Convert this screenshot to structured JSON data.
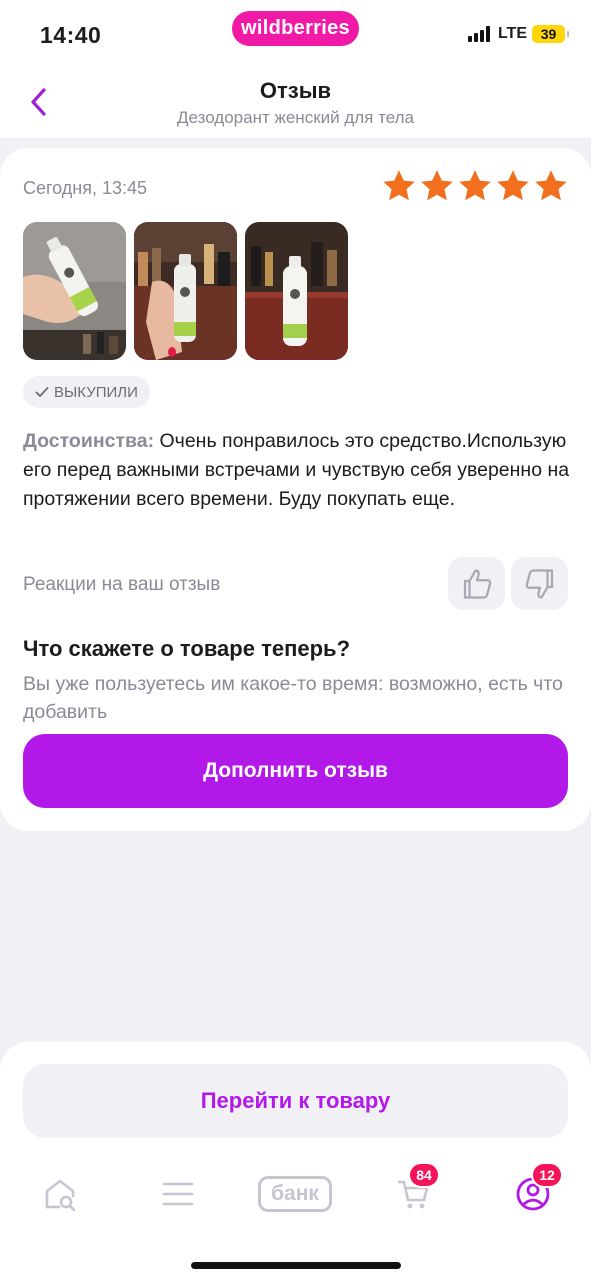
{
  "status_bar": {
    "time": "14:40",
    "brand": "wildberries",
    "network": "LTE",
    "battery": "39"
  },
  "header": {
    "title": "Отзыв",
    "subtitle": "Дезодорант женский для тела"
  },
  "review": {
    "date": "Сегодня, 13:45",
    "rating": 5,
    "photos": [
      "photo-1",
      "photo-2",
      "photo-3"
    ],
    "badge": "ВЫКУПИЛИ",
    "pros_label": "Достоинства:",
    "pros_text": "Очень понравилось это средство.Использую его перед важными встречами и чувствую себя уверенно на протяжении всего времени. Буду покупать еще.",
    "reactions_label": "Реакции на ваш отзыв"
  },
  "followup": {
    "title": "Что скажете о товаре теперь?",
    "description": "Вы уже пользуетесь им какое-то время: возможно, есть что добавить",
    "button_label": "Дополнить отзыв"
  },
  "bottom": {
    "go_to_product_label": "Перейти к товару"
  },
  "tabbar": {
    "bank_label": "банк",
    "cart_count": "84",
    "profile_count": "12"
  },
  "colors": {
    "accent": "#b219e8",
    "brand_pink": "#f01aa6",
    "star": "#f26f1e",
    "badge_red": "#f5135a"
  }
}
